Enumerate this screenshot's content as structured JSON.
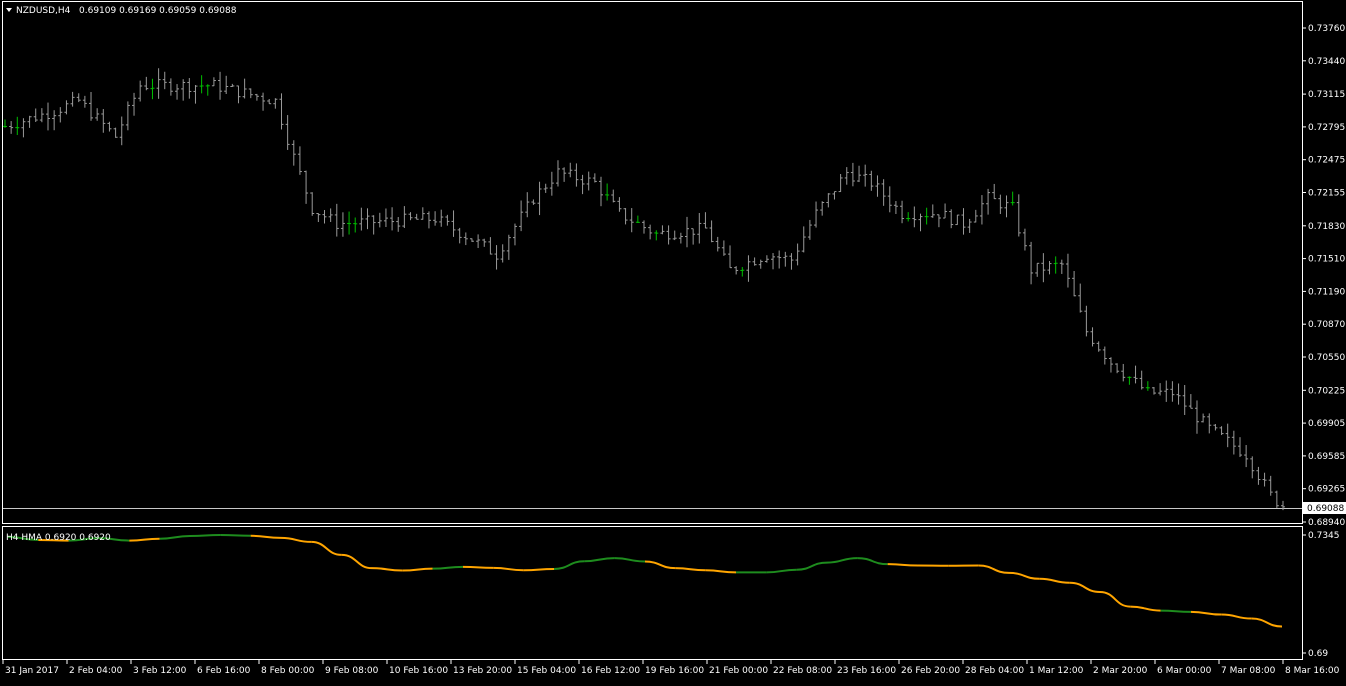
{
  "window": {
    "symbol_label": "NZDUSD,H4",
    "ohlc_label": "0.69109 0.69169 0.69059 0.69088",
    "indicator_label": "H4 HMA 0.6920 0.6920"
  },
  "colors": {
    "background": "#000000",
    "grid_border": "#ffffff",
    "bar": "#9a9a9a",
    "bar_bull": "#00c000",
    "hma_up": "#1e8c1e",
    "hma_down": "#ffa500",
    "text": "#ffffff"
  },
  "chart_data": [
    {
      "type": "ohlc",
      "timeframe": "H4",
      "y_ticks": [
        "0.73760",
        "0.73440",
        "0.73115",
        "0.72795",
        "0.72475",
        "0.72155",
        "0.71830",
        "0.71510",
        "0.71190",
        "0.70870",
        "0.70550",
        "0.70225",
        "0.69905",
        "0.69585",
        "0.69265",
        "0.68940"
      ],
      "ylim": [
        0.6894,
        0.7376
      ],
      "current_price": "0.69088",
      "x_labels": [
        "31 Jan 2017",
        "2 Feb 04:00",
        "3 Feb 12:00",
        "6 Feb 16:00",
        "8 Feb 00:00",
        "9 Feb 08:00",
        "10 Feb 16:00",
        "13 Feb 20:00",
        "15 Feb 04:00",
        "16 Feb 12:00",
        "19 Feb 16:00",
        "21 Feb 00:00",
        "22 Feb 08:00",
        "23 Feb 16:00",
        "26 Feb 20:00",
        "28 Feb 04:00",
        "1 Mar 12:00",
        "2 Mar 20:00",
        "6 Mar 00:00",
        "7 Mar 08:00",
        "8 Mar 16:00"
      ],
      "keypoints": [
        {
          "i": 0,
          "c": 0.728
        },
        {
          "i": 8,
          "c": 0.7295
        },
        {
          "i": 12,
          "c": 0.7305
        },
        {
          "i": 18,
          "c": 0.727
        },
        {
          "i": 22,
          "c": 0.732
        },
        {
          "i": 32,
          "c": 0.732
        },
        {
          "i": 34,
          "c": 0.732
        },
        {
          "i": 44,
          "c": 0.7305
        },
        {
          "i": 47,
          "c": 0.725
        },
        {
          "i": 50,
          "c": 0.72
        },
        {
          "i": 54,
          "c": 0.7185
        },
        {
          "i": 70,
          "c": 0.719
        },
        {
          "i": 76,
          "c": 0.717
        },
        {
          "i": 80,
          "c": 0.7155
        },
        {
          "i": 86,
          "c": 0.721
        },
        {
          "i": 90,
          "c": 0.7235
        },
        {
          "i": 96,
          "c": 0.7225
        },
        {
          "i": 100,
          "c": 0.7195
        },
        {
          "i": 106,
          "c": 0.7175
        },
        {
          "i": 114,
          "c": 0.718
        },
        {
          "i": 118,
          "c": 0.714
        },
        {
          "i": 124,
          "c": 0.7155
        },
        {
          "i": 128,
          "c": 0.715
        },
        {
          "i": 132,
          "c": 0.7195
        },
        {
          "i": 137,
          "c": 0.7235
        },
        {
          "i": 141,
          "c": 0.7225
        },
        {
          "i": 146,
          "c": 0.7195
        },
        {
          "i": 152,
          "c": 0.7195
        },
        {
          "i": 156,
          "c": 0.7185
        },
        {
          "i": 160,
          "c": 0.721
        },
        {
          "i": 164,
          "c": 0.72
        },
        {
          "i": 167,
          "c": 0.714
        },
        {
          "i": 172,
          "c": 0.7145
        },
        {
          "i": 176,
          "c": 0.708
        },
        {
          "i": 180,
          "c": 0.705
        },
        {
          "i": 186,
          "c": 0.702
        },
        {
          "i": 190,
          "c": 0.702
        },
        {
          "i": 196,
          "c": 0.6985
        },
        {
          "i": 202,
          "c": 0.696
        },
        {
          "i": 206,
          "c": 0.692
        },
        {
          "i": 208,
          "c": 0.69088
        }
      ]
    },
    {
      "type": "line",
      "name": "H4 HMA",
      "ylim": [
        0.69,
        0.7345
      ],
      "y_ticks": [
        "0.7345",
        "0.69"
      ],
      "values": [
        0.7338,
        0.7326,
        0.7324,
        0.7333,
        0.7324,
        0.7331,
        0.7341,
        0.7345,
        0.7342,
        0.7334,
        0.7319,
        0.727,
        0.722,
        0.7211,
        0.7218,
        0.7225,
        0.7221,
        0.7212,
        0.7217,
        0.7246,
        0.7258,
        0.7245,
        0.722,
        0.7212,
        0.7204,
        0.7204,
        0.7214,
        0.7241,
        0.7258,
        0.7235,
        0.723,
        0.7229,
        0.723,
        0.7202,
        0.718,
        0.7165,
        0.713,
        0.7075,
        0.706,
        0.7055,
        0.7045,
        0.703,
        0.7
      ],
      "up": [
        1,
        0,
        1,
        1,
        0,
        1,
        1,
        1,
        0,
        0,
        0,
        0,
        0,
        0,
        1,
        0,
        0,
        0,
        1,
        1,
        1,
        0,
        0,
        0,
        1,
        1,
        1,
        1,
        1,
        0,
        0,
        0,
        0,
        0,
        0,
        0,
        0,
        0,
        1,
        0,
        0,
        0,
        0
      ]
    }
  ]
}
